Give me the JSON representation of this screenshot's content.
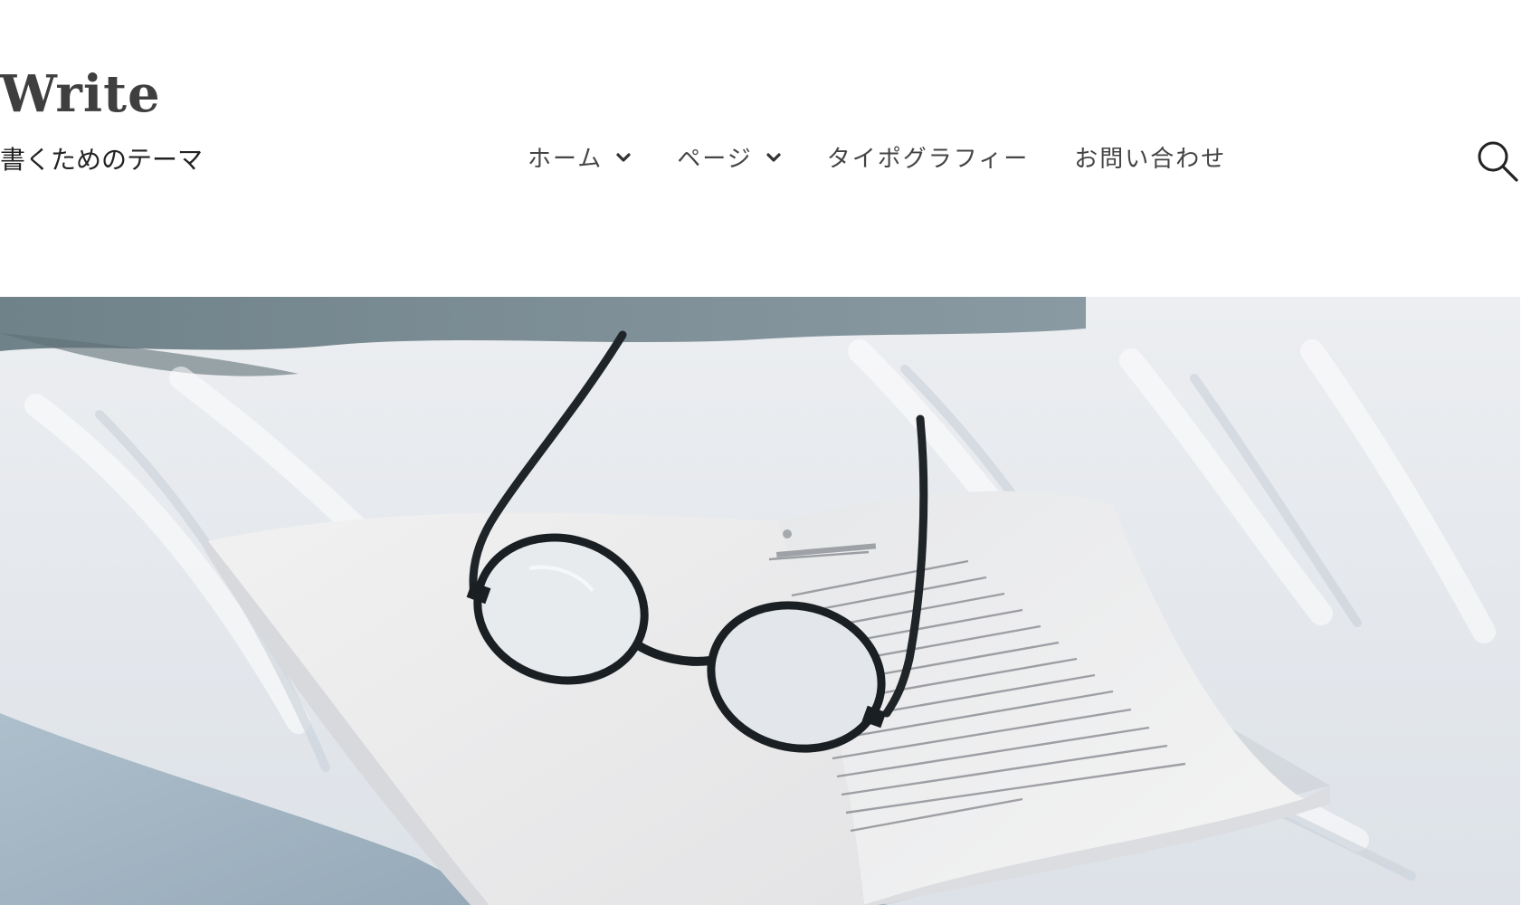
{
  "site": {
    "title": "Write",
    "tagline": "書くためのテーマ"
  },
  "nav": {
    "items": [
      {
        "label": "ホーム",
        "has_dropdown": true
      },
      {
        "label": "ページ",
        "has_dropdown": true
      },
      {
        "label": "タイポグラフィー",
        "has_dropdown": false
      },
      {
        "label": "お問い合わせ",
        "has_dropdown": false
      }
    ]
  },
  "icons": {
    "search": "search-icon",
    "dropdown": "chevron-down-icon"
  },
  "hero": {
    "subject": "hero-image"
  }
}
